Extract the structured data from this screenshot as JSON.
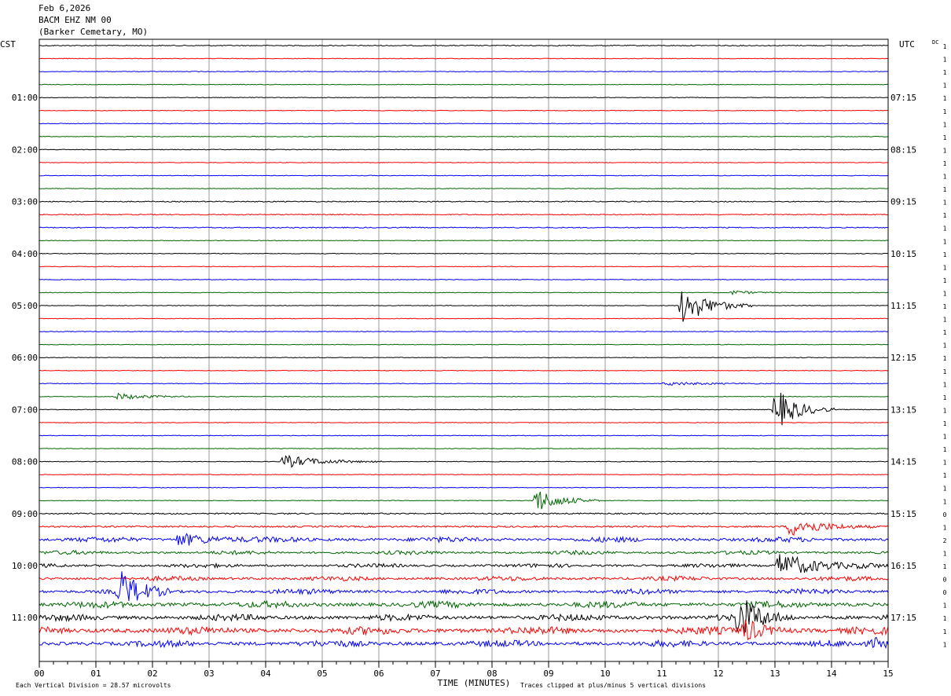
{
  "header": {
    "date": "Feb 6,2026",
    "station": "BACM EHZ NM 00",
    "site": "(Barker Cemetary, MO)"
  },
  "colors": {
    "trace_cycle": [
      "#000000",
      "#ff0000",
      "#0000ff",
      "#006600"
    ],
    "grid": "#999999"
  },
  "chart_data": {
    "type": "line",
    "title": "",
    "xlabel": "TIME (MINUTES)",
    "left_axis_label": "CST",
    "right_axis_label": "UTC",
    "dc_label": "DC",
    "footer_left": "Each Vertical Division =   28.57 microvolts",
    "footer_right": "Traces clipped at plus/minus 5 vertical divisions",
    "xlim": [
      0,
      15
    ],
    "x_ticks": [
      "00",
      "01",
      "02",
      "03",
      "04",
      "05",
      "06",
      "07",
      "08",
      "09",
      "10",
      "11",
      "12",
      "13",
      "14",
      "15"
    ],
    "row_count": 47,
    "row_minutes": 15,
    "left_hour_labels": [
      "01:00",
      "02:00",
      "03:00",
      "04:00",
      "05:00",
      "06:00",
      "07:00",
      "08:00",
      "09:00",
      "10:00",
      "11:00"
    ],
    "right_hour_labels": [
      "07:15",
      "08:15",
      "09:15",
      "10:15",
      "11:15",
      "12:15",
      "13:15",
      "14:15",
      "15:15",
      "16:15",
      "17:15"
    ],
    "dc_values": [
      "1",
      "1",
      "1",
      "1",
      "1",
      "1",
      "1",
      "1",
      "1",
      "1",
      "1",
      "1",
      "1",
      "1",
      "1",
      "1",
      "1",
      "1",
      "1",
      "1",
      "1",
      "1",
      "1",
      "1",
      "1",
      "1",
      "1",
      "1",
      "1",
      "1",
      "1",
      "1",
      "1",
      "1",
      "1",
      "1",
      "0",
      "1",
      "2",
      "1",
      "1",
      "0",
      "0",
      "1",
      "1",
      "1",
      "1"
    ],
    "row_noise": [
      0.3,
      0.2,
      0.2,
      0.2,
      0.2,
      0.2,
      0.2,
      0.2,
      0.2,
      0.2,
      0.2,
      0.2,
      0.3,
      0.3,
      0.3,
      0.2,
      0.2,
      0.2,
      0.2,
      0.2,
      0.2,
      0.2,
      0.2,
      0.2,
      0.2,
      0.2,
      0.2,
      0.2,
      0.2,
      0.2,
      0.2,
      0.2,
      0.2,
      0.2,
      0.2,
      0.2,
      0.4,
      0.5,
      0.8,
      0.6,
      0.6,
      0.7,
      0.8,
      1.0,
      1.0,
      1.2,
      1.0
    ],
    "events": [
      {
        "row": 20,
        "start_min": 11.3,
        "duration_min": 0.7,
        "amplitude": 4.5
      },
      {
        "row": 19,
        "start_min": 12.2,
        "duration_min": 0.4,
        "amplitude": 0.5
      },
      {
        "row": 26,
        "start_min": 11.0,
        "duration_min": 1.5,
        "amplitude": 0.4
      },
      {
        "row": 27,
        "start_min": 1.3,
        "duration_min": 0.8,
        "amplitude": 0.8
      },
      {
        "row": 28,
        "start_min": 12.95,
        "duration_min": 0.5,
        "amplitude": 5.0
      },
      {
        "row": 32,
        "start_min": 4.25,
        "duration_min": 1.2,
        "amplitude": 1.5
      },
      {
        "row": 35,
        "start_min": 8.7,
        "duration_min": 0.6,
        "amplitude": 3.0
      },
      {
        "row": 37,
        "start_min": 13.2,
        "duration_min": 1.0,
        "amplitude": 2.2
      },
      {
        "row": 38,
        "start_min": 2.4,
        "duration_min": 1.0,
        "amplitude": 1.5
      },
      {
        "row": 40,
        "start_min": 13.0,
        "duration_min": 1.2,
        "amplitude": 3.0
      },
      {
        "row": 42,
        "start_min": 1.35,
        "duration_min": 0.4,
        "amplitude": 5.0
      },
      {
        "row": 44,
        "start_min": 12.3,
        "duration_min": 0.45,
        "amplitude": 5.0
      },
      {
        "row": 45,
        "start_min": 12.4,
        "duration_min": 0.3,
        "amplitude": 3.0
      },
      {
        "row": 46,
        "start_min": 14.7,
        "duration_min": 0.3,
        "amplitude": 1.2
      }
    ]
  }
}
